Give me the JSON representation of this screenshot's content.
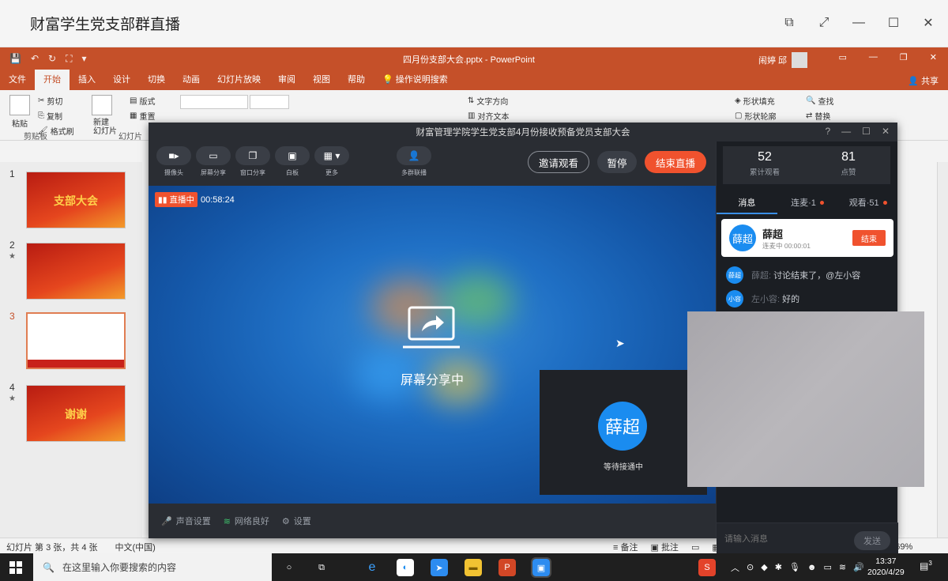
{
  "window": {
    "title": "财富学生党支部群直播"
  },
  "ppt": {
    "doc_title": "四月份支部大会.pptx  -  PowerPoint",
    "user_name": "闹婷 邱",
    "share": "共享",
    "tabs": [
      "文件",
      "开始",
      "插入",
      "设计",
      "切换",
      "动画",
      "幻灯片放映",
      "审阅",
      "视图",
      "帮助",
      "操作说明搜索"
    ],
    "ribbon": {
      "paste": "粘贴",
      "cut": "剪切",
      "copy": "复制",
      "format_painter": "格式刷",
      "clipboard_label": "剪贴板",
      "new_slide": "新建\n幻灯片",
      "layout": "版式",
      "reset": "重置",
      "slides_label": "幻灯片",
      "text_direction": "文字方向",
      "align_text": "对齐文本",
      "shape_fill": "形状填充",
      "shape_outline": "形状轮廓",
      "find": "查找",
      "replace": "替换"
    },
    "slides": [
      {
        "num": "1",
        "text": "支部大会",
        "star": ""
      },
      {
        "num": "2",
        "text": "",
        "star": "★"
      },
      {
        "num": "3",
        "text": "",
        "star": ""
      },
      {
        "num": "4",
        "text": "谢谢",
        "star": "★"
      }
    ],
    "status": {
      "slide_info": "幻灯片 第 3 张，共 4 张",
      "language": "中文(中国)",
      "notes": "备注",
      "comments": "批注",
      "zoom": "69%"
    }
  },
  "live": {
    "title": "财富管理学院学生党支部4月份接收预备党员支部大会",
    "tools": [
      "摄像头",
      "屏幕分享",
      "窗口分享",
      "白板",
      "更多",
      "多群联播"
    ],
    "invite": "邀请观看",
    "pause": "暂停",
    "end_live": "结束直播",
    "live_tag": "直播中",
    "live_time": "00:58:24",
    "sharing_text": "屏幕分享中",
    "pip_name": "薛超",
    "pip_status": "等待接通中",
    "bottom": {
      "audio": "声音设置",
      "network": "网络良好",
      "settings": "设置"
    },
    "stats": {
      "views": "52",
      "views_label": "累计观看",
      "likes": "81",
      "likes_label": "点赞"
    },
    "side_tabs": [
      {
        "label": "消息",
        "dot": false
      },
      {
        "label": "连麦·1",
        "dot": true
      },
      {
        "label": "观看·51",
        "dot": true
      }
    ],
    "link_card": {
      "avatar": "薛超",
      "name": "薛超",
      "status": "连麦中 00:00:01",
      "end": "结束"
    },
    "messages": [
      {
        "avatar": "薛超",
        "name": "薛超:",
        "text": "讨论结束了，@左小容"
      },
      {
        "avatar": "小容",
        "name": "左小容:",
        "text": "好的"
      }
    ],
    "input_placeholder": "请输入消息",
    "send": "发送"
  },
  "taskbar": {
    "search_placeholder": "在这里输入你要搜索的内容",
    "time": "13:37",
    "date": "2020/4/29",
    "notif_count": "3"
  },
  "colors": {
    "ppt_accent": "#c55029",
    "live_red": "#f0522e",
    "avatar_blue": "#1a8cf0"
  }
}
